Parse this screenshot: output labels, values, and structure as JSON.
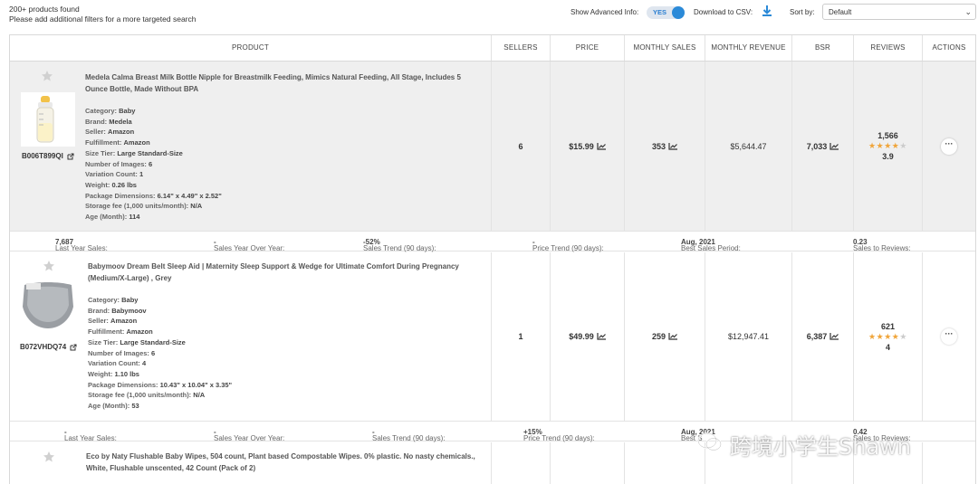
{
  "header": {
    "found": "200+ products found",
    "hint": "Please add additional filters for a more targeted search",
    "advanced_label": "Show Advanced Info:",
    "advanced_value": "YES",
    "csv_label": "Download to CSV:",
    "sort_label": "Sort by:",
    "sort_value": "Default"
  },
  "columns": [
    "PRODUCT",
    "SELLERS",
    "PRICE",
    "MONTHLY SALES",
    "MONTHLY REVENUE",
    "BSR",
    "REVIEWS",
    "ACTIONS"
  ],
  "products": [
    {
      "title": "Medela Calma Breast Milk Bottle Nipple for Breastmilk Feeding, Mimics Natural Feeding, All Stage, Includes 5 Ounce Bottle, Made Without BPA",
      "asin": "B006T899QI",
      "category_label": "Category:",
      "category": "Baby",
      "brand_label": "Brand:",
      "brand": "Medela",
      "seller_label": "Seller:",
      "seller": "Amazon",
      "fulfillment_label": "Fulfillment:",
      "fulfillment": "Amazon",
      "size_label": "Size Tier:",
      "size": "Large Standard-Size",
      "images_label": "Number of Images:",
      "images": "6",
      "variation_label": "Variation Count:",
      "variation": "1",
      "weight_label": "Weight:",
      "weight": "0.26 lbs",
      "dims_label": "Package Dimensions:",
      "dims": "6.14\" x 4.49\" x 2.52\"",
      "storage_label": "Storage fee (1,000 units/month):",
      "storage": "N/A",
      "age_label": "Age (Month):",
      "age": "114",
      "sellers": "6",
      "price": "$15.99",
      "monthly_sales": "353",
      "monthly_revenue": "$5,644.47",
      "bsr": "7,033",
      "review_count": "1,566",
      "rating": "3.9",
      "stars_filled": 4,
      "summary": {
        "last_year_label": "Last Year Sales:",
        "last_year": "7,687",
        "yoy_label": "Sales Year Over Year:",
        "yoy": "-",
        "trend_label": "Sales Trend (90 days):",
        "trend": "-52%",
        "price_trend_label": "Price Trend (90 days):",
        "price_trend": "-",
        "best_period_label": "Best Sales Period:",
        "best_period": "Aug, 2021",
        "s2r_label": "Sales to Reviews:",
        "s2r": "0.23"
      }
    },
    {
      "title": "Babymoov Dream Belt Sleep Aid | Maternity Sleep Support & Wedge for Ultimate Comfort During Pregnancy (Medium/X-Large) , Grey",
      "asin": "B072VHDQ74",
      "category_label": "Category:",
      "category": "Baby",
      "brand_label": "Brand:",
      "brand": "Babymoov",
      "seller_label": "Seller:",
      "seller": "Amazon",
      "fulfillment_label": "Fulfillment:",
      "fulfillment": "Amazon",
      "size_label": "Size Tier:",
      "size": "Large Standard-Size",
      "images_label": "Number of Images:",
      "images": "6",
      "variation_label": "Variation Count:",
      "variation": "4",
      "weight_label": "Weight:",
      "weight": "1.10 lbs",
      "dims_label": "Package Dimensions:",
      "dims": "10.43\" x 10.04\" x 3.35\"",
      "storage_label": "Storage fee (1,000 units/month):",
      "storage": "N/A",
      "age_label": "Age (Month):",
      "age": "53",
      "sellers": "1",
      "price": "$49.99",
      "monthly_sales": "259",
      "monthly_revenue": "$12,947.41",
      "bsr": "6,387",
      "review_count": "621",
      "rating": "4",
      "stars_filled": 4,
      "summary": {
        "last_year_label": "Last Year Sales:",
        "last_year": "-",
        "yoy_label": "Sales Year Over Year:",
        "yoy": "-",
        "trend_label": "Sales Trend (90 days):",
        "trend": "-",
        "price_trend_label": "Price Trend (90 days):",
        "price_trend": "+15%",
        "best_period_label": "Best S",
        "best_period": "Aug, 2021",
        "s2r_label": "Sales to Reviews:",
        "s2r": "0.42"
      }
    },
    {
      "title": "Eco by Naty Flushable Baby Wipes, 504 count, Plant based Compostable Wipes. 0% plastic. No nasty chemicals., White, Flushable unscented, 42 Count (Pack of 2)"
    }
  ],
  "watermark": "跨境小学生Shawn",
  "colors": {
    "accent": "#2b8ad8",
    "star": "#f0a53a",
    "negative": "#e24a4a",
    "positive": "#2fa54a"
  }
}
